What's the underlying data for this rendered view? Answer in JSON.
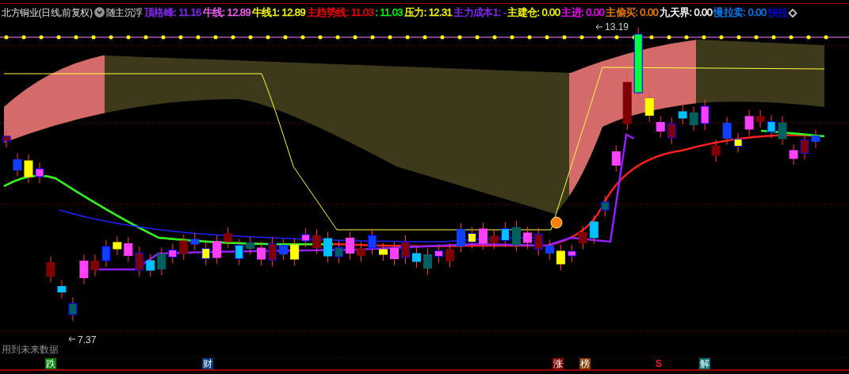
{
  "header": {
    "title": "北方铜业(日线,前复权)",
    "indicator": "随主沉浮",
    "items": [
      {
        "text": "顶格峰: 11.16",
        "color": "#8b2cff"
      },
      {
        "text": "牛线: 12.89",
        "color": "#ff66ff"
      },
      {
        "text": "牛线1: 12.89",
        "color": "#ffff00"
      },
      {
        "text": "主趋势线: 11.03",
        "color": "#ff0000"
      },
      {
        "text": ": 11.03",
        "color": "#00ff00"
      },
      {
        "text": "压力: 12.31",
        "color": "#ffff00"
      },
      {
        "text": "主力成本1: -",
        "color": "#8b2cff"
      },
      {
        "text": "主建仓: 0.00",
        "color": "#ffff00"
      },
      {
        "text": "主进: 0.00",
        "color": "#ff00ff"
      },
      {
        "text": "主偷买: 0.00",
        "color": "#ff8000"
      },
      {
        "text": "九天界: 0.00",
        "color": "#ffffff"
      },
      {
        "text": "慢拉卖: 0.00",
        "color": "#0080ff"
      },
      {
        "text": "快拉",
        "color": "#0000ff"
      },
      {
        "text": "◇",
        "color": "#c0c0c0"
      }
    ]
  },
  "chart": {
    "high_label": "13.19",
    "low_label": "7.37",
    "note": "用到未来数据"
  },
  "markers": [
    {
      "text": "跌",
      "color": "#008000"
    },
    {
      "text": "财",
      "color": "#003a80"
    },
    {
      "text": "涨",
      "color": "#800000"
    },
    {
      "text": "榜",
      "color": "#804000"
    },
    {
      "text": "S",
      "color": "#000000"
    },
    {
      "text": "解",
      "color": "#007070"
    }
  ]
}
